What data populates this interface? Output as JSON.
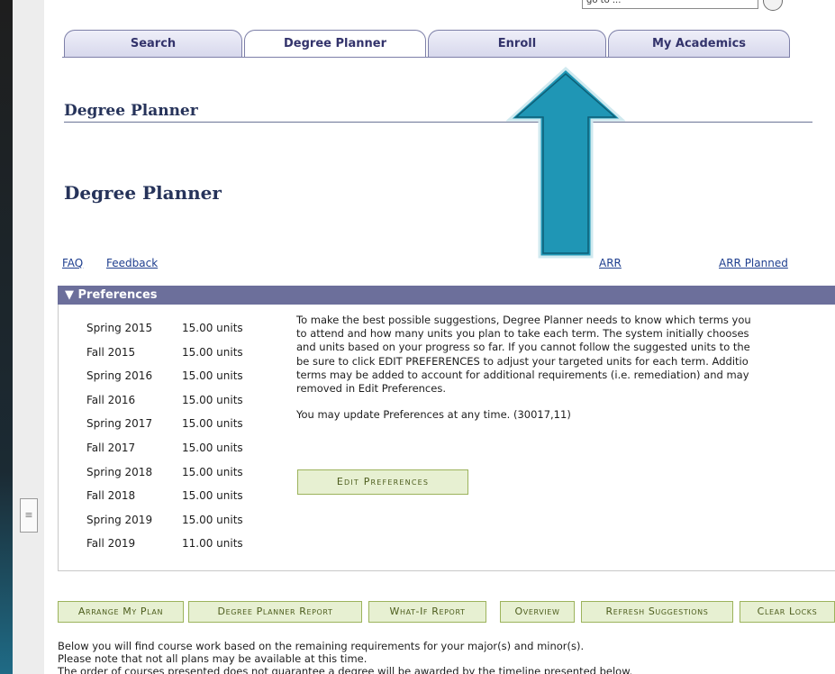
{
  "search": {
    "goto_value": "go to ..."
  },
  "tabs": [
    {
      "label": "Search"
    },
    {
      "label": "Degree Planner"
    },
    {
      "label": "Enroll"
    },
    {
      "label": "My Academics"
    }
  ],
  "header": {
    "title": "Degree Planner",
    "subtitle": "Degree Planner"
  },
  "links": {
    "faq": "FAQ",
    "feedback": "Feedback",
    "arr": "ARR",
    "arr_planned": "ARR Planned"
  },
  "preferences": {
    "title": "Preferences",
    "terms": [
      {
        "term": "Spring 2015",
        "units": "15.00 units"
      },
      {
        "term": "Fall 2015",
        "units": "15.00 units"
      },
      {
        "term": "Spring 2016",
        "units": "15.00 units"
      },
      {
        "term": "Fall 2016",
        "units": "15.00 units"
      },
      {
        "term": "Spring 2017",
        "units": "15.00 units"
      },
      {
        "term": "Fall 2017",
        "units": "15.00 units"
      },
      {
        "term": "Spring 2018",
        "units": "15.00 units"
      },
      {
        "term": "Fall 2018",
        "units": "15.00 units"
      },
      {
        "term": "Spring 2019",
        "units": "15.00 units"
      },
      {
        "term": "Fall 2019",
        "units": "11.00 units"
      }
    ],
    "info_lines": [
      "To make the best possible suggestions, Degree Planner needs to know which terms you",
      "to attend and how many units you plan to take each term. The system initially chooses",
      "and units based on your progress so far. If you cannot follow the suggested units to the",
      "be sure to click EDIT PREFERENCES to adjust your targeted units for each term. Additio",
      "terms may be added to account for additional requirements (i.e. remediation) and may",
      "removed in Edit Preferences."
    ],
    "update_note": "You may update Preferences at any time. (30017,11)",
    "edit_button": "Edit Preferences"
  },
  "actions": {
    "arrange": "Arrange My Plan",
    "report": "Degree Planner Report",
    "whatif": "What-If Report",
    "overview": "Overview",
    "refresh": "Refresh Suggestions",
    "clear": "Clear Locks"
  },
  "footer_lines": [
    "Below you will find course work based on the remaining requirements for your major(s) and minor(s).",
    "Please note that not all plans may be available at this time.",
    "The order of courses presented does not guarantee a degree will be awarded by the timeline presented below."
  ],
  "colors": {
    "tab_text": "#33336b",
    "prefs_bar": "#6c6f9b",
    "button_bg": "#e7f0d2",
    "arrow_fill": "#1f96b5"
  }
}
